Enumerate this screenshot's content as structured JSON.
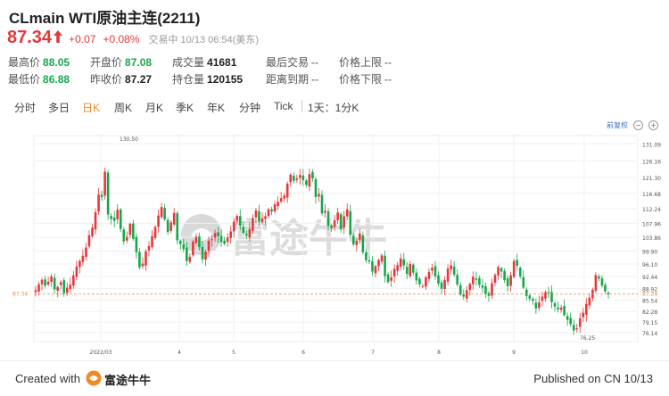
{
  "header": {
    "title": "CLmain WTI原油主连(2211)",
    "price": "87.34",
    "change": "+0.07",
    "change_pct": "+0.08%",
    "status": "交易中 10/13 06:54(美东)"
  },
  "stats": {
    "high_label": "最高价",
    "high": "88.05",
    "low_label": "最低价",
    "low": "86.88",
    "open_label": "开盘价",
    "open": "87.08",
    "prev_close_label": "昨收价",
    "prev_close": "87.27",
    "volume_label": "成交量",
    "volume": "41681",
    "open_interest_label": "持仓量",
    "open_interest": "120155",
    "last_trade_label": "最后交易",
    "last_trade": "--",
    "to_expiry_label": "距离到期",
    "to_expiry": "--",
    "upper_limit_label": "价格上限",
    "upper_limit": "--",
    "lower_limit_label": "价格下限",
    "lower_limit": "--"
  },
  "tabs": [
    "分时",
    "多日",
    "日K",
    "周K",
    "月K",
    "季K",
    "年K",
    "分钟",
    "Tick",
    "1天：1分K"
  ],
  "active_tab": "日K",
  "toolbar": {
    "rights_label": "前复权",
    "zoom_out_icon": "zoom-out-icon",
    "zoom_in_icon": "zoom-in-icon"
  },
  "watermark": "富途牛牛",
  "footer": {
    "created_with": "Created with",
    "brand": "富途牛牛",
    "published": "Published on CN 10/13"
  },
  "colors": {
    "up": "#e5383b",
    "down": "#14a84a",
    "accent": "#f08a24",
    "ref_line": "#e8884a"
  },
  "chart_data": {
    "type": "candlestick",
    "y_ticks": [
      131.09,
      126.16,
      121.3,
      116.68,
      112.24,
      107.96,
      103.86,
      99.9,
      96.1,
      92.44,
      88.92,
      85.54,
      82.28,
      79.15,
      76.14
    ],
    "ylim": [
      73.5,
      133.5
    ],
    "x_tick_labels": [
      "2022/03",
      "4",
      "5",
      "6",
      "7",
      "8",
      "9",
      "10"
    ],
    "last_price_label": "87.34",
    "max_label": "130.50",
    "min_label": "76.25",
    "close_series": [
      88.5,
      90.2,
      91.5,
      89.8,
      90.9,
      92.5,
      88.7,
      89.4,
      90.8,
      87.6,
      89.2,
      90.1,
      92.8,
      95.4,
      97.0,
      98.5,
      100.9,
      104.5,
      106.7,
      111.2,
      116.3,
      115.6,
      123.0,
      110.5,
      109.2,
      108.7,
      111.9,
      106.3,
      102.7,
      104.0,
      107.8,
      103.4,
      99.5,
      95.1,
      96.2,
      99.8,
      101.3,
      104.2,
      106.9,
      110.2,
      112.7,
      109.1,
      105.4,
      108.2,
      111.0,
      103.0,
      101.9,
      100.4,
      97.0,
      98.2,
      102.6,
      104.0,
      101.0,
      97.5,
      99.7,
      102.9,
      103.3,
      105.1,
      104.2,
      102.5,
      102.0,
      103.8,
      105.6,
      108.4,
      110.1,
      107.3,
      105.2,
      104.4,
      106.3,
      109.5,
      111.7,
      108.5,
      109.4,
      110.0,
      112.0,
      111.4,
      113.5,
      114.2,
      115.3,
      116.0,
      119.5,
      122.1,
      120.3,
      121.0,
      122.0,
      120.5,
      119.1,
      122.3,
      121.0,
      115.6,
      116.5,
      110.8,
      111.6,
      107.2,
      106.5,
      108.8,
      111.1,
      106.2,
      110.0,
      112.0,
      104.6,
      101.8,
      102.8,
      105.0,
      99.5,
      97.2,
      96.8,
      93.9,
      95.5,
      97.3,
      98.6,
      92.6,
      90.8,
      92.2,
      94.7,
      95.8,
      97.7,
      95.7,
      93.2,
      96.1,
      93.6,
      91.3,
      90.2,
      89.7,
      92.2,
      93.8,
      95.0,
      92.5,
      90.4,
      88.9,
      91.4,
      94.8,
      95.7,
      93.0,
      90.1,
      87.2,
      86.6,
      88.5,
      90.3,
      92.4,
      91.5,
      90.0,
      89.2,
      87.3,
      86.8,
      90.5,
      92.9,
      95.2,
      93.9,
      91.4,
      89.6,
      92.8,
      97.0,
      95.6,
      92.5,
      89.2,
      86.8,
      86.0,
      85.4,
      83.1,
      84.9,
      86.6,
      87.9,
      87.6,
      85.0,
      83.7,
      82.9,
      83.4,
      81.2,
      79.8,
      78.6,
      76.7,
      77.4,
      80.3,
      81.9,
      84.5,
      86.3,
      88.6,
      92.9,
      91.9,
      89.8,
      88.1,
      87.3
    ]
  }
}
